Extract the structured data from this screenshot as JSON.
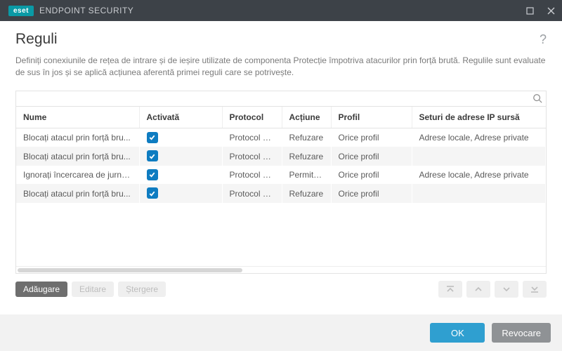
{
  "titlebar": {
    "brand_tag": "eset",
    "brand_text": "ENDPOINT SECURITY"
  },
  "page": {
    "title": "Reguli",
    "description": "Definiți conexiunile de rețea de intrare și de ieșire utilizate de componenta Protecție împotriva atacurilor prin forță brută. Regulile sunt evaluate de sus în jos și se aplică acțiunea aferentă primei reguli care se potrivește."
  },
  "columns": {
    "name": "Nume",
    "enabled": "Activată",
    "protocol": "Protocol",
    "action": "Acțiune",
    "profile": "Profil",
    "source_ip": "Seturi de adrese IP sursă"
  },
  "rows": [
    {
      "name": "Blocați atacul prin forță bru...",
      "enabled": true,
      "protocol": "Protocol Des...",
      "action": "Refuzare",
      "profile": "Orice profil",
      "source_ip": "Adrese locale, Adrese private"
    },
    {
      "name": "Blocați atacul prin forță bru...",
      "enabled": true,
      "protocol": "Protocol Des...",
      "action": "Refuzare",
      "profile": "Orice profil",
      "source_ip": ""
    },
    {
      "name": "Ignorați încercarea de jurnali...",
      "enabled": true,
      "protocol": "Protocol Ser...",
      "action": "Permitere",
      "profile": "Orice profil",
      "source_ip": "Adrese locale, Adrese private"
    },
    {
      "name": "Blocați atacul prin forță bru...",
      "enabled": true,
      "protocol": "Protocol Ser...",
      "action": "Refuzare",
      "profile": "Orice profil",
      "source_ip": ""
    }
  ],
  "actions": {
    "add": "Adăugare",
    "edit": "Editare",
    "delete": "Ștergere"
  },
  "footer": {
    "ok": "OK",
    "cancel": "Revocare"
  }
}
